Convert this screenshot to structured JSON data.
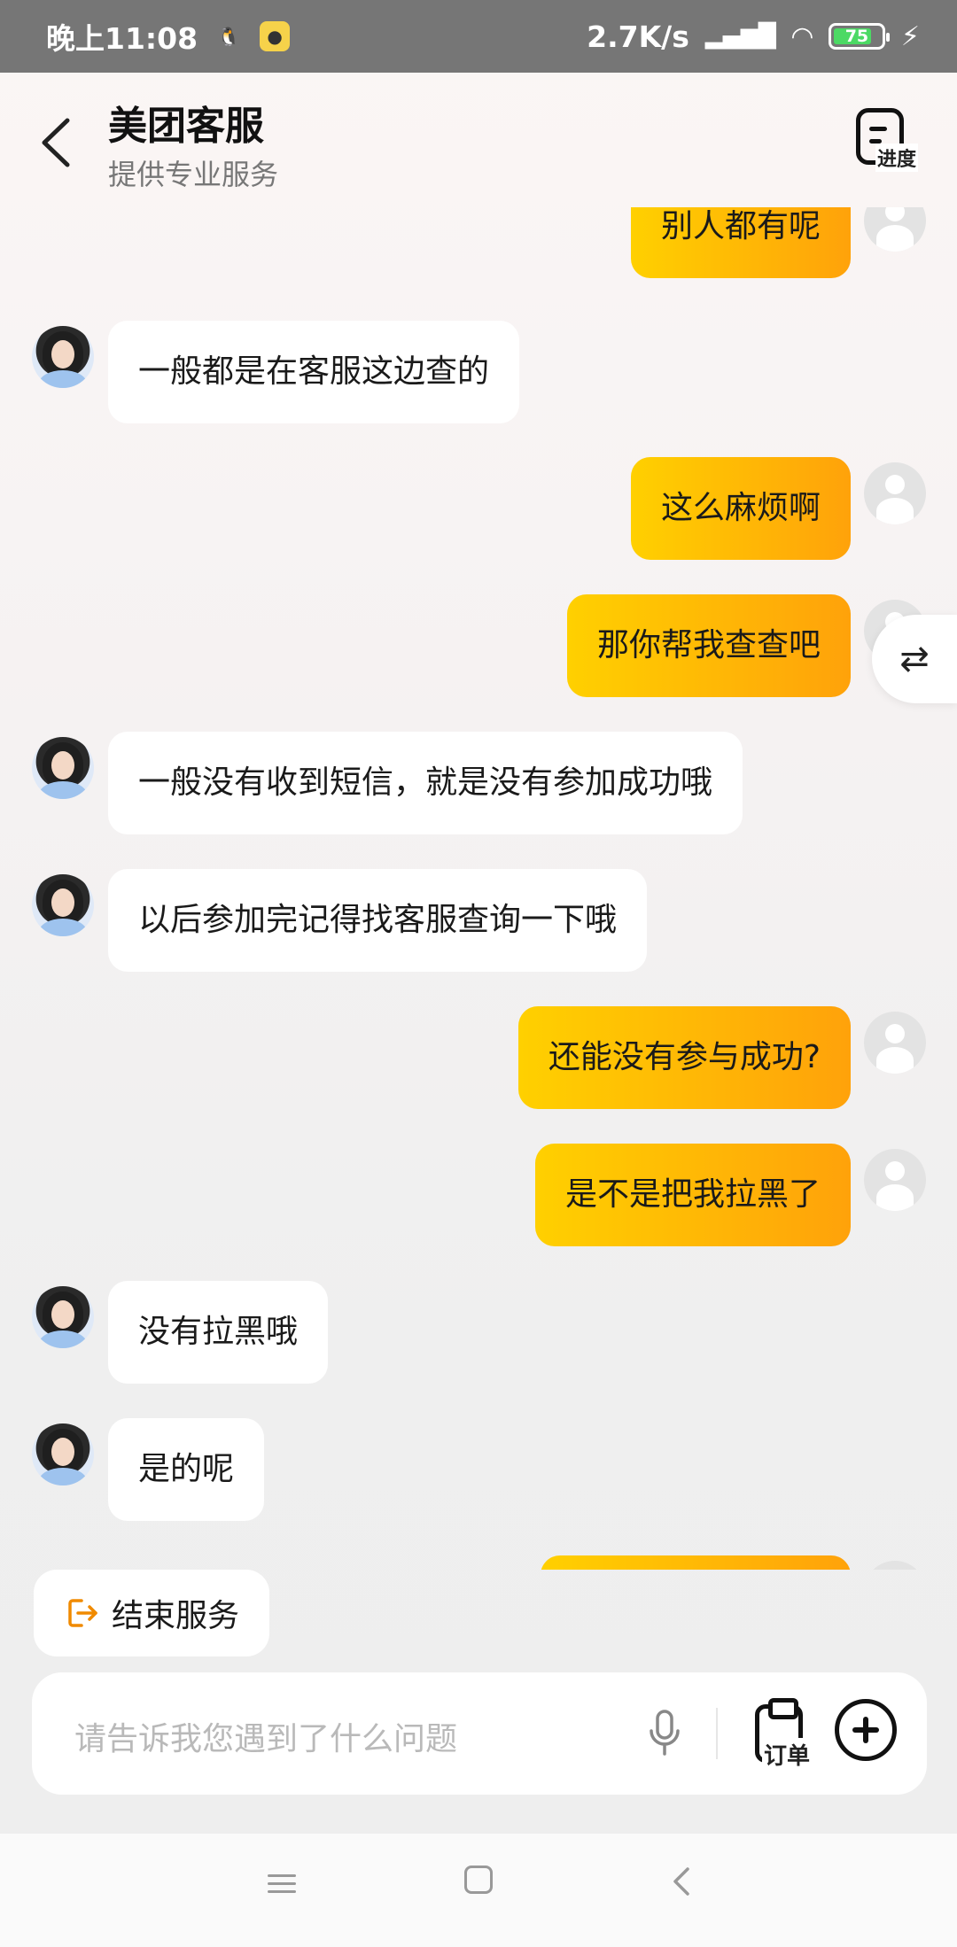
{
  "status_bar": {
    "time": "晚上11:08",
    "network_speed": "2.7K/s",
    "battery": "75"
  },
  "header": {
    "title": "美团客服",
    "subtitle": "提供专业服务",
    "progress_label": "进度"
  },
  "messages": [
    {
      "role": "user",
      "text": "别人都有呢"
    },
    {
      "role": "agent",
      "text": "一般都是在客服这边查的"
    },
    {
      "role": "user",
      "text": "这么麻烦啊"
    },
    {
      "role": "user",
      "text": "那你帮我查查吧"
    },
    {
      "role": "agent",
      "text": "一般没有收到短信，就是没有参加成功哦"
    },
    {
      "role": "agent",
      "text": "以后参加完记得找客服查询一下哦"
    },
    {
      "role": "user",
      "text": "还能没有参与成功?"
    },
    {
      "role": "user",
      "text": "是不是把我拉黑了"
    },
    {
      "role": "agent",
      "text": "没有拉黑哦"
    },
    {
      "role": "agent",
      "text": "是的呢"
    }
  ],
  "end_service_label": "结束服务",
  "input": {
    "placeholder": "请告诉我您遇到了什么问题",
    "order_label": "订单"
  },
  "colors": {
    "user_bubble_start": "#ffd000",
    "user_bubble_end": "#ffa20a",
    "exit_icon": "#f08a00"
  }
}
